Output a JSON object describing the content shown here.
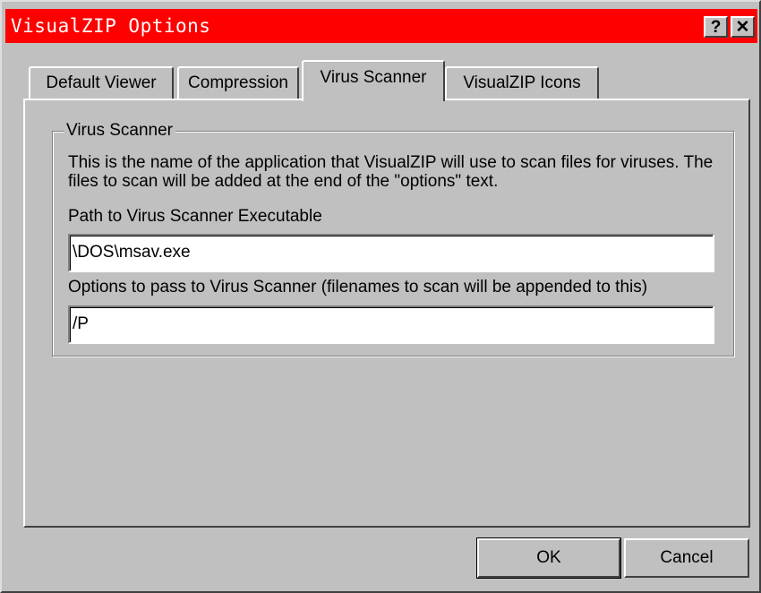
{
  "window": {
    "title": "VisualZIP Options",
    "help_label": "?",
    "close_label": "✕"
  },
  "tabs": [
    {
      "label": "Default Viewer",
      "active": false
    },
    {
      "label": "Compression",
      "active": false
    },
    {
      "label": "Virus Scanner",
      "active": true
    },
    {
      "label": "VisualZIP Icons",
      "active": false
    }
  ],
  "group": {
    "title": "Virus Scanner",
    "description": "This is the name of the application that VisualZIP will use to scan files for viruses.  The files to scan will be added at the end of the \"options\" text."
  },
  "fields": {
    "path_label": "Path to Virus Scanner Executable",
    "path_value": "\\DOS\\msav.exe",
    "options_label": "Options to pass to Virus Scanner (filenames to scan will be appended to this)",
    "options_value": "/P"
  },
  "buttons": {
    "ok": "OK",
    "cancel": "Cancel"
  },
  "colors": {
    "titlebar": "#ff0000",
    "face": "#c0c0c0"
  }
}
